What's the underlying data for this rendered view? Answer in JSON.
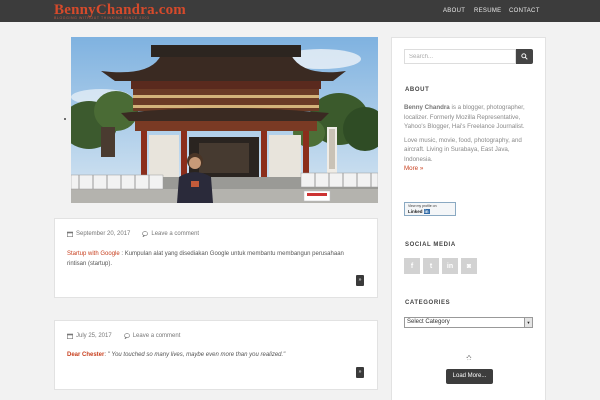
{
  "site": {
    "logo": "BennyChandra.com",
    "tagline": "BLOGGING WITHOUT THINKING SINCE 2003"
  },
  "nav": {
    "items": [
      {
        "label": "ABOUT"
      },
      {
        "label": "RESUME"
      },
      {
        "label": "CONTACT"
      }
    ]
  },
  "posts": [
    {
      "date": "September 20, 2017",
      "comments": "Leave a comment",
      "title_link": "Startup with Google",
      "separator": " : ",
      "body": "Kumpulan alat yang disediakan Google untuk membantu membangun perusahaan rintisan (startup).",
      "more_label": "»"
    },
    {
      "date": "July 25, 2017",
      "comments": "Leave a comment",
      "title_link": "Dear Chester",
      "separator": ": ",
      "body": "\" You touched so many lives, maybe even more than you realized.\"",
      "more_label": "»"
    }
  ],
  "sidebar": {
    "search": {
      "placeholder": "Search..."
    },
    "about": {
      "title": "ABOUT",
      "name": "Benny Chandra",
      "bio": " is a blogger, photographer, localizer. Formerly Mozilla Representative, Yahoo's Blogger, Hai's Freelance Journalist.",
      "bio2": "Love music, movie, food, photography, and aircraft. Living in Surabaya, East Java, Indonesia.",
      "more": "More »"
    },
    "linkedin": {
      "line1": "View my profile on",
      "line2": "Linked",
      "line3": "in"
    },
    "social": {
      "title": "SOCIAL MEDIA",
      "buttons": [
        {
          "label": "f",
          "icon": "facebook-icon"
        },
        {
          "label": "t",
          "icon": "twitter-icon"
        },
        {
          "label": "in",
          "icon": "linkedin-icon"
        },
        {
          "label": "◙",
          "icon": "instagram-icon"
        }
      ]
    },
    "categories": {
      "title": "CATEGORIES",
      "selected": "Select Category"
    },
    "load_more": "Load More..."
  },
  "colors": {
    "accent": "#c8401f",
    "topbar": "#3c3c3c",
    "button": "#3d3d3d"
  }
}
